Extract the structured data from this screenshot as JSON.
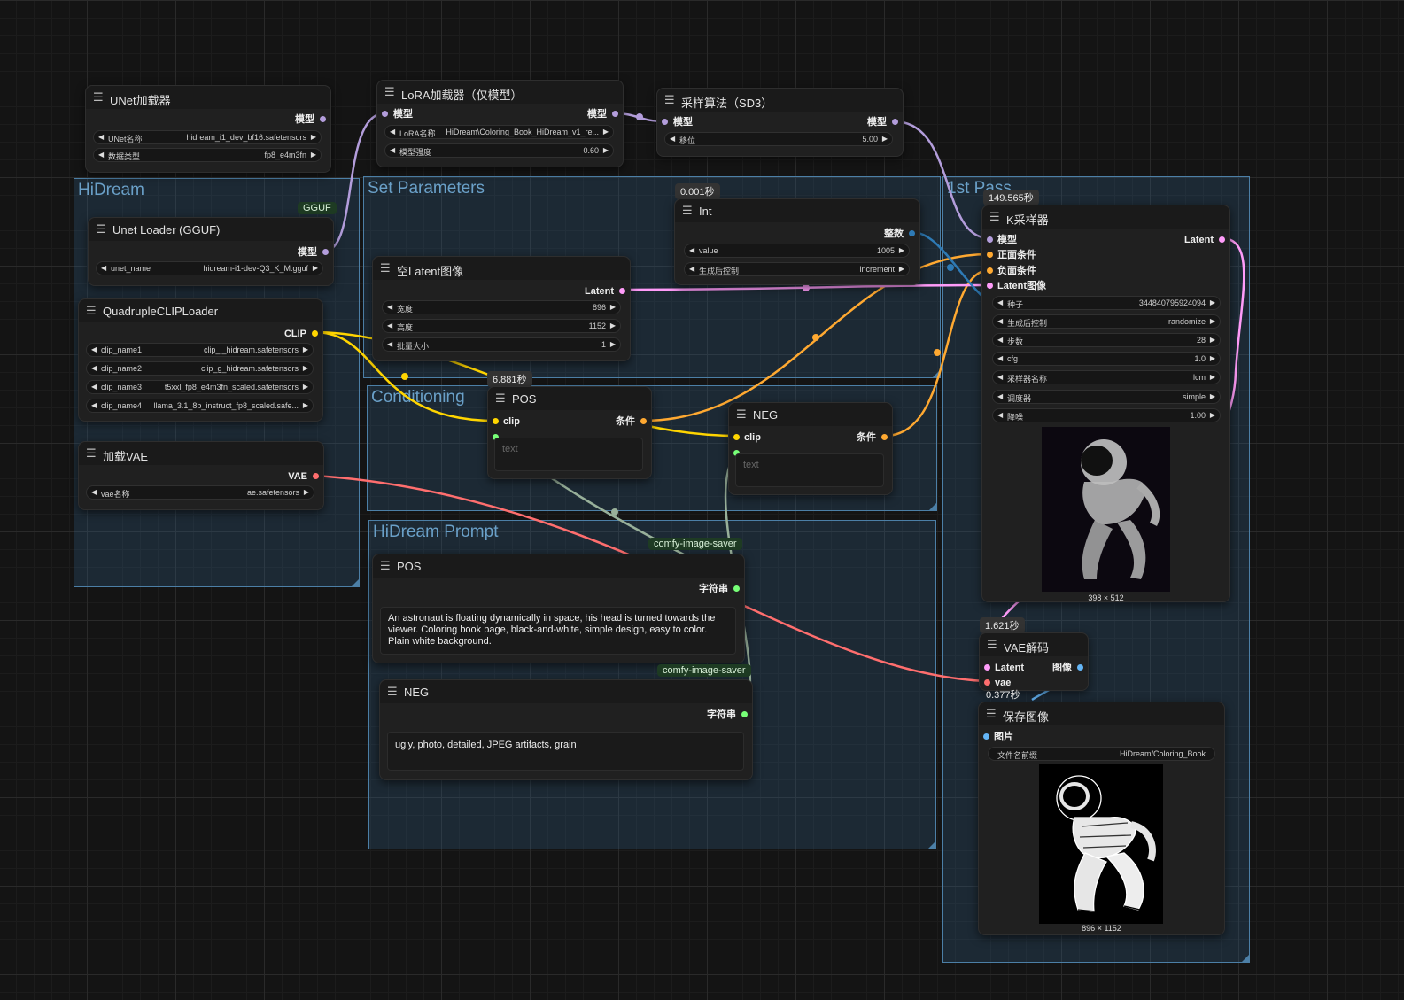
{
  "groups": {
    "hidream": "HiDream",
    "set_params": "Set Parameters",
    "conditioning": "Conditioning",
    "prompt": "HiDream Prompt",
    "first_pass": "1st Pass"
  },
  "unet_loader": {
    "title": "UNet加载器",
    "out_model": "模型",
    "w_name_label": "UNet名称",
    "w_name_value": "hidream_i1_dev_bf16.safetensors",
    "w_dtype_label": "数据类型",
    "w_dtype_value": "fp8_e4m3fn"
  },
  "lora_loader": {
    "title": "LoRA加载器（仅模型）",
    "in_model": "模型",
    "out_model": "模型",
    "w_name_label": "LoRA名称",
    "w_name_value": "HiDream\\Coloring_Book_HiDream_v1_re...",
    "w_strength_label": "模型强度",
    "w_strength_value": "0.60"
  },
  "sampling_sd3": {
    "title": "采样算法（SD3）",
    "in_model": "模型",
    "out_model": "模型",
    "w_shift_label": "移位",
    "w_shift_value": "5.00"
  },
  "gguf_loader": {
    "badge": "GGUF",
    "title": "Unet Loader (GGUF)",
    "out_model": "模型",
    "w_name_label": "unet_name",
    "w_name_value": "hidream-i1-dev-Q3_K_M.gguf"
  },
  "clip_loader": {
    "title": "QuadrupleCLIPLoader",
    "out_clip": "CLIP",
    "widgets": [
      {
        "label": "clip_name1",
        "value": "clip_l_hidream.safetensors"
      },
      {
        "label": "clip_name2",
        "value": "clip_g_hidream.safetensors"
      },
      {
        "label": "clip_name3",
        "value": "t5xxl_fp8_e4m3fn_scaled.safetensors"
      },
      {
        "label": "clip_name4",
        "value": "llama_3.1_8b_instruct_fp8_scaled.safe..."
      }
    ]
  },
  "vae_loader": {
    "title": "加载VAE",
    "out_vae": "VAE",
    "w_label": "vae名称",
    "w_value": "ae.safetensors"
  },
  "empty_latent": {
    "title": "空Latent图像",
    "out_latent": "Latent",
    "widgets": [
      {
        "label": "宽度",
        "value": "896"
      },
      {
        "label": "高度",
        "value": "1152"
      },
      {
        "label": "批量大小",
        "value": "1"
      }
    ]
  },
  "int_node": {
    "time": "0.001秒",
    "title": "Int",
    "out_int": "整数",
    "w_value_label": "value",
    "w_value_value": "1005",
    "w_ctrl_label": "生成后控制",
    "w_ctrl_value": "increment"
  },
  "pos_encode": {
    "time": "6.881秒",
    "title": "POS",
    "in_clip": "clip",
    "out_cond": "条件",
    "placeholder": "text"
  },
  "neg_encode": {
    "title": "NEG",
    "in_clip": "clip",
    "out_cond": "条件",
    "placeholder": "text"
  },
  "pos_prompt": {
    "badge": "comfy-image-saver",
    "title": "POS",
    "out_str": "字符串",
    "text": "An astronaut is floating dynamically in space, his head is turned towards the viewer. Coloring book page, black-and-white, simple design, easy to color. Plain white background."
  },
  "neg_prompt": {
    "badge": "comfy-image-saver",
    "title": "NEG",
    "out_str": "字符串",
    "text": "ugly, photo, detailed, JPEG artifacts, grain"
  },
  "ksampler": {
    "time": "149.565秒",
    "title": "K采样器",
    "in_model": "模型",
    "in_pos": "正面条件",
    "in_neg": "负面条件",
    "in_latent": "Latent图像",
    "out_latent": "Latent",
    "widgets": [
      {
        "label": "种子",
        "value": "344840795924094"
      },
      {
        "label": "生成后控制",
        "value": "randomize"
      },
      {
        "label": "步数",
        "value": "28"
      },
      {
        "label": "cfg",
        "value": "1.0"
      },
      {
        "label": "采样器名称",
        "value": "lcm"
      },
      {
        "label": "调度器",
        "value": "simple"
      },
      {
        "label": "降噪",
        "value": "1.00"
      }
    ],
    "preview_size": "398 × 512"
  },
  "vae_decode": {
    "time": "1.621秒",
    "title": "VAE解码",
    "in_latent": "Latent",
    "in_vae": "vae",
    "out_image": "图像"
  },
  "save_image": {
    "time": "0.377秒",
    "title": "保存图像",
    "in_image": "图片",
    "w_prefix_label": "文件名前缀",
    "w_prefix_value": "HiDream/Coloring_Book",
    "preview_size": "896 × 1152"
  },
  "colors": {
    "model": "#b39ddb",
    "clip": "#ffd500",
    "conditioning": "#ffa931",
    "latent": "#ff9cf9",
    "vae": "#ff6e6e",
    "image": "#64b5f6",
    "string": "#77ff77",
    "int": "#2e7ab5"
  }
}
